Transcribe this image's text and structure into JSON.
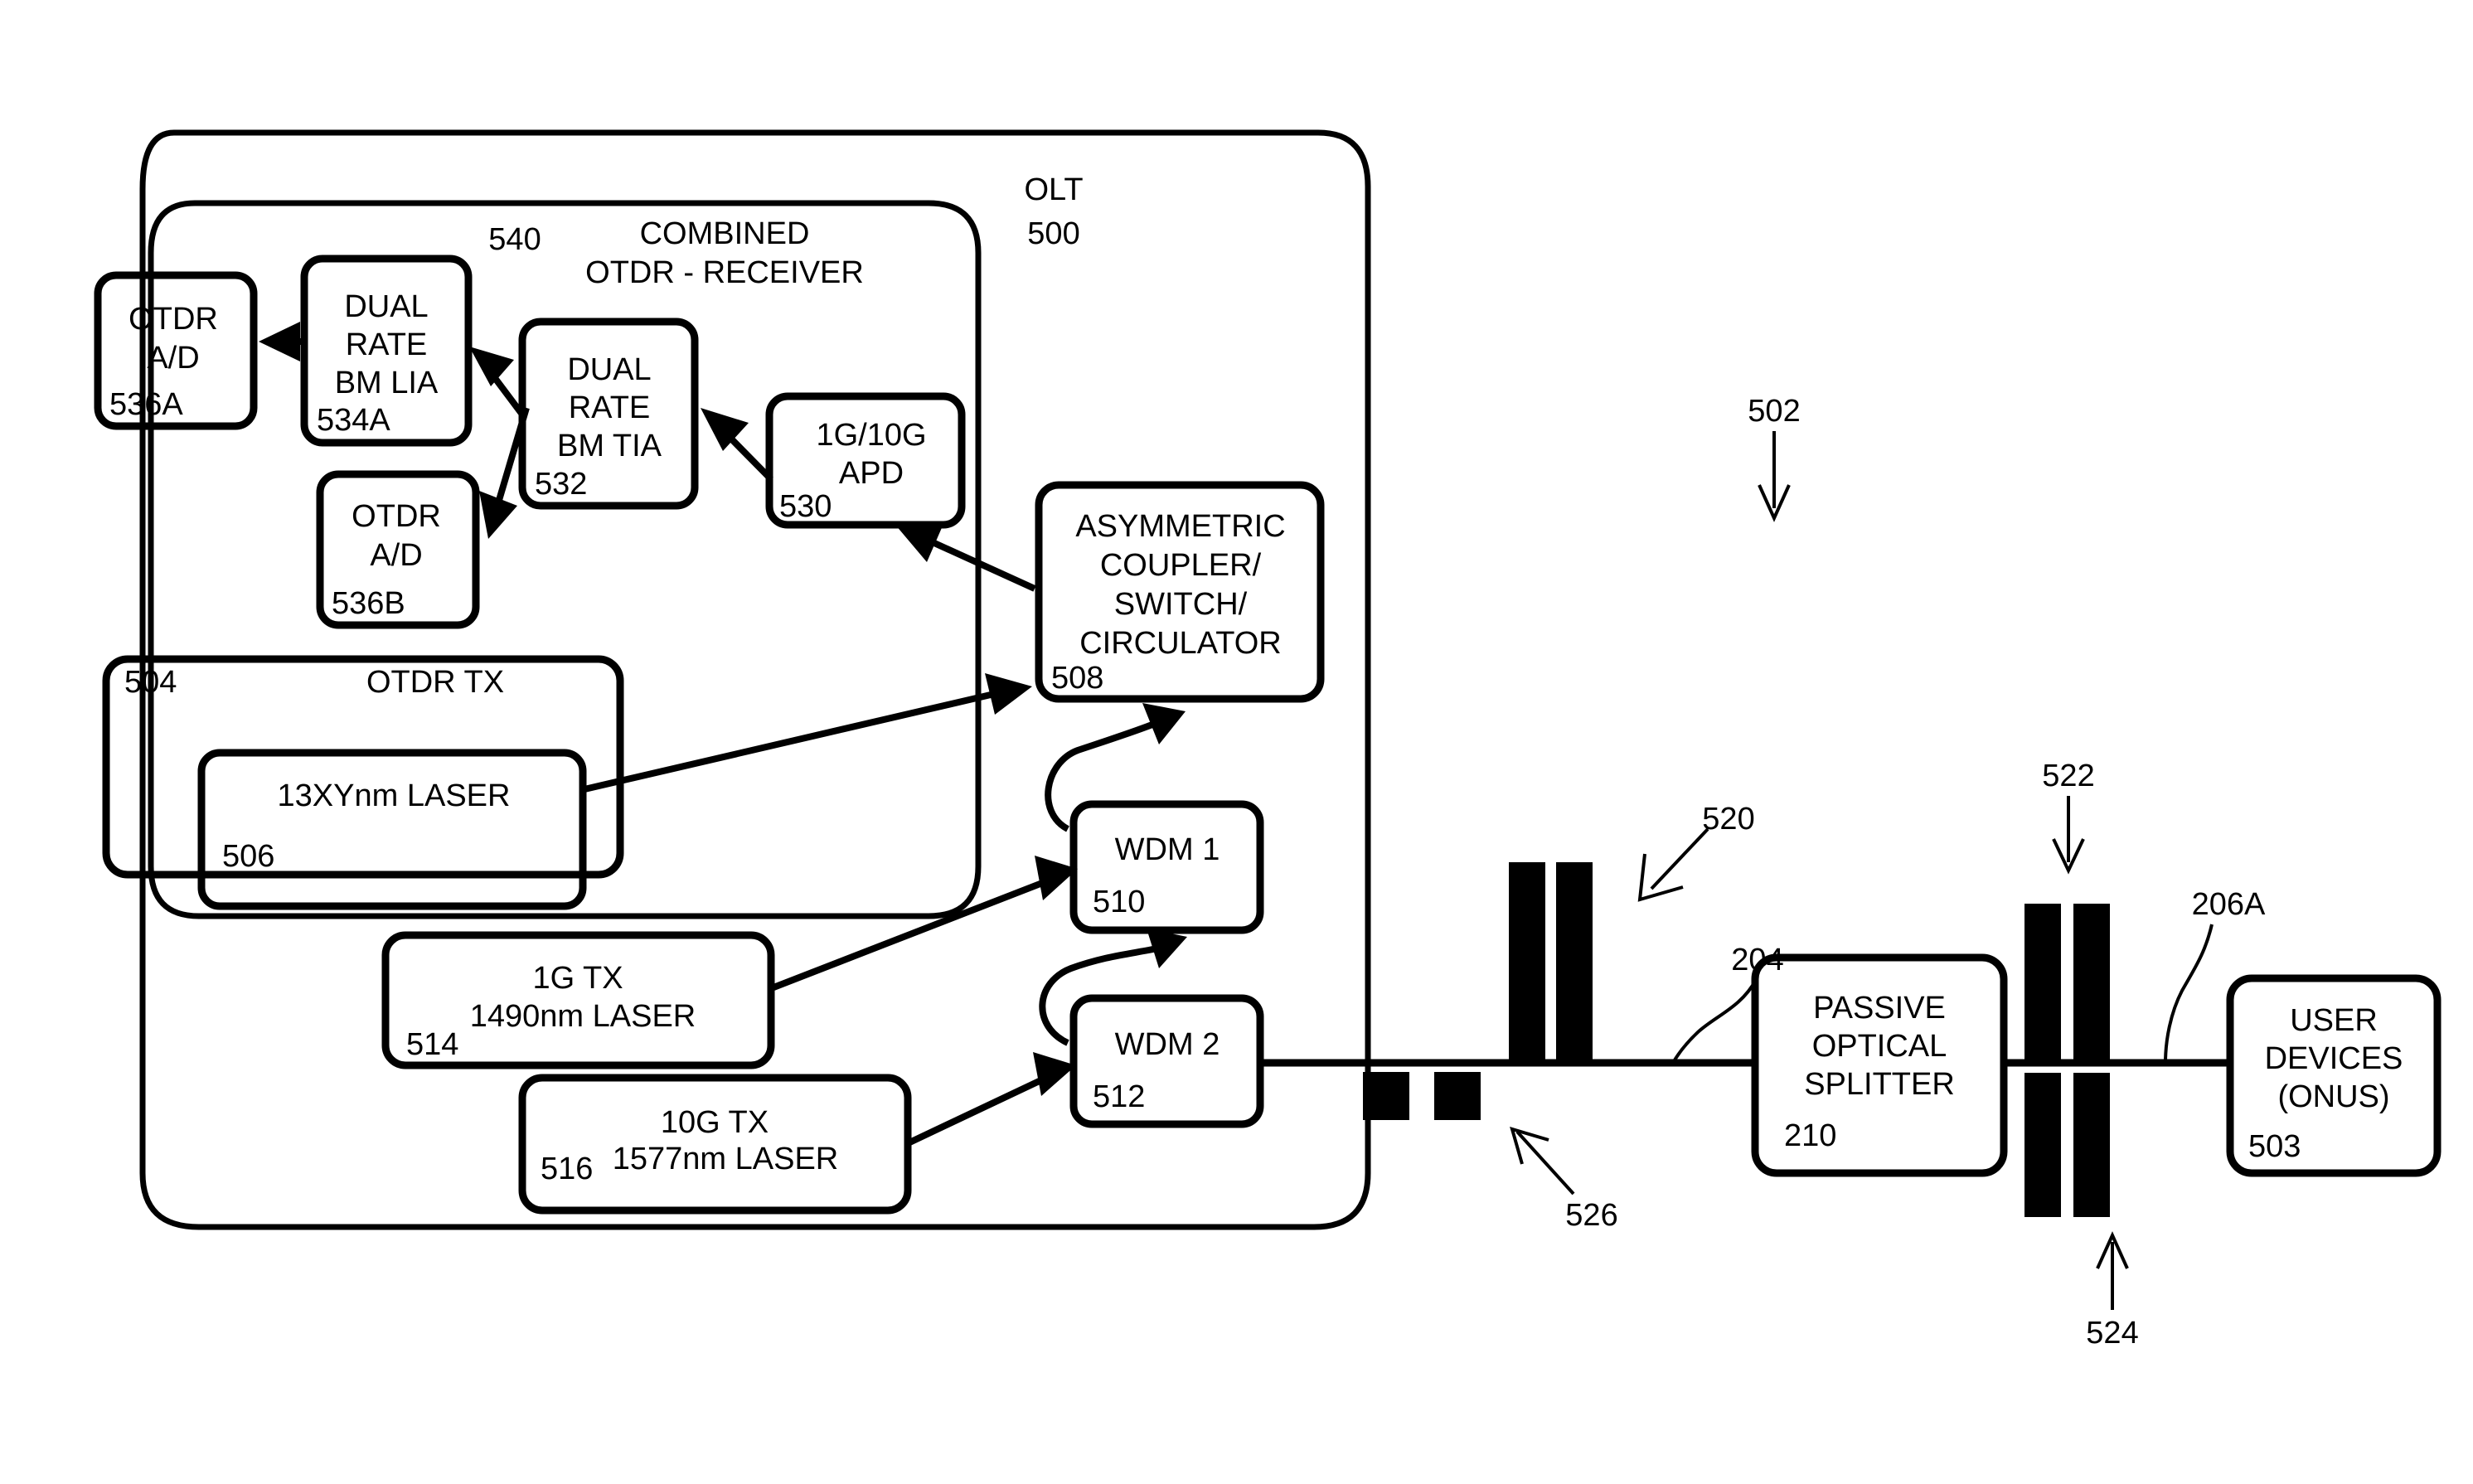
{
  "figure": {
    "type": "patent-block-diagram",
    "title_label": "OLT",
    "title_ref": "500"
  },
  "outer_container": {
    "name": "OLT",
    "label": "OLT",
    "ref": "500"
  },
  "inner_container": {
    "label_line1": "COMBINED",
    "label_line2": "OTDR - RECEIVER",
    "ref": "540"
  },
  "blocks": [
    {
      "id": "otdr-ad-a",
      "lines": [
        "OTDR",
        "A/D"
      ],
      "ref": "536A"
    },
    {
      "id": "dual-rate-bm-lia",
      "lines": [
        "DUAL",
        "RATE",
        "BM LIA"
      ],
      "ref": "534A"
    },
    {
      "id": "dual-rate-bm-tia",
      "lines": [
        "DUAL",
        "RATE",
        "BM TIA"
      ],
      "ref": "532"
    },
    {
      "id": "apd",
      "lines": [
        "1G/10G",
        "APD"
      ],
      "ref": "530"
    },
    {
      "id": "otdr-ad-b",
      "lines": [
        "OTDR",
        "A/D"
      ],
      "ref": "536B"
    },
    {
      "id": "otdr-tx",
      "lines": [
        "OTDR TX"
      ],
      "ref": "504"
    },
    {
      "id": "otdr-laser",
      "lines": [
        "13XYnm LASER"
      ],
      "ref": "506"
    },
    {
      "id": "asymmetric-coupler",
      "lines": [
        "ASYMMETRIC",
        "COUPLER/",
        "SWITCH/",
        "CIRCULATOR"
      ],
      "ref": "508"
    },
    {
      "id": "wdm-1",
      "lines": [
        "WDM 1"
      ],
      "ref": "510"
    },
    {
      "id": "wdm-2",
      "lines": [
        "WDM 2"
      ],
      "ref": "512"
    },
    {
      "id": "tx-1g",
      "lines": [
        "1G TX",
        "1490nm LASER"
      ],
      "ref": "514"
    },
    {
      "id": "tx-10g",
      "lines": [
        "10G  TX",
        "1577nm LASER"
      ],
      "ref": "516"
    },
    {
      "id": "passive-splitter",
      "lines": [
        "PASSIVE",
        "OPTICAL",
        "SPLITTER"
      ],
      "ref": "210"
    },
    {
      "id": "user-devices",
      "lines": [
        "USER",
        "DEVICES",
        "(ONUS)"
      ],
      "ref": "503"
    }
  ],
  "block_text": {
    "otdr_ad_a_l1": "OTDR",
    "otdr_ad_a_l2": "A/D",
    "otdr_ad_a_ref": "536A",
    "lia_l1": "DUAL",
    "lia_l2": "RATE",
    "lia_l3": "BM LIA",
    "lia_ref": "534A",
    "tia_l1": "DUAL",
    "tia_l2": "RATE",
    "tia_l3": "BM TIA",
    "tia_ref": "532",
    "apd_l1": "1G/10G",
    "apd_l2": "APD",
    "apd_ref": "530",
    "otdr_ad_b_l1": "OTDR",
    "otdr_ad_b_l2": "A/D",
    "otdr_ad_b_ref": "536B",
    "otdr_tx_title": "OTDR TX",
    "otdr_tx_ref": "504",
    "otdr_laser_label": "13XYnm LASER",
    "otdr_laser_ref": "506",
    "coupler_l1": "ASYMMETRIC",
    "coupler_l2": "COUPLER/",
    "coupler_l3": "SWITCH/",
    "coupler_l4": "CIRCULATOR",
    "coupler_ref": "508",
    "wdm1_label": "WDM 1",
    "wdm1_ref": "510",
    "wdm2_label": "WDM 2",
    "wdm2_ref": "512",
    "tx1g_l1": "1G TX",
    "tx1g_l2": "1490nm LASER",
    "tx1g_ref": "514",
    "tx10g_l1": "10G  TX",
    "tx10g_l2": "1577nm LASER",
    "tx10g_ref": "516",
    "splitter_l1": "PASSIVE",
    "splitter_l2": "OPTICAL",
    "splitter_l3": "SPLITTER",
    "splitter_ref": "210",
    "onu_l1": "USER",
    "onu_l2": "DEVICES",
    "onu_l3": "(ONUS)",
    "onu_ref": "503"
  },
  "reference_callouts": [
    {
      "id": "ref-502",
      "text": "502",
      "kind": "arrow-down"
    },
    {
      "id": "ref-520",
      "text": "520",
      "kind": "arrow-down-left"
    },
    {
      "id": "ref-522",
      "text": "522",
      "kind": "arrow-down"
    },
    {
      "id": "ref-524",
      "text": "524",
      "kind": "arrow-up"
    },
    {
      "id": "ref-526",
      "text": "526",
      "kind": "arrow-up-left"
    },
    {
      "id": "ref-204",
      "text": "204",
      "kind": "leader-curve"
    },
    {
      "id": "ref-206A",
      "text": "206A",
      "kind": "leader-curve"
    }
  ],
  "callout_text": {
    "c502": "502",
    "c520": "520",
    "c522": "522",
    "c524": "524",
    "c526": "526",
    "c204": "204",
    "c206A": "206A",
    "olt_title": "OLT",
    "olt_ref": "500",
    "combined_l1": "COMBINED",
    "combined_l2": "OTDR - RECEIVER",
    "combined_ref": "540"
  },
  "fiber_markers": [
    {
      "id": "marker-526",
      "ref": "526",
      "count": 2,
      "position": "below-line",
      "note": "small squares"
    },
    {
      "id": "marker-520",
      "ref": "520",
      "count": 2,
      "position": "above-line",
      "note": "tall bars"
    },
    {
      "id": "marker-522",
      "ref": "522",
      "count": 2,
      "position": "above-line",
      "note": "tall bars"
    },
    {
      "id": "marker-524",
      "ref": "524",
      "count": 2,
      "position": "below-line",
      "note": "tall bars"
    }
  ],
  "colors": {
    "ink": "#000000",
    "paper": "#ffffff"
  }
}
